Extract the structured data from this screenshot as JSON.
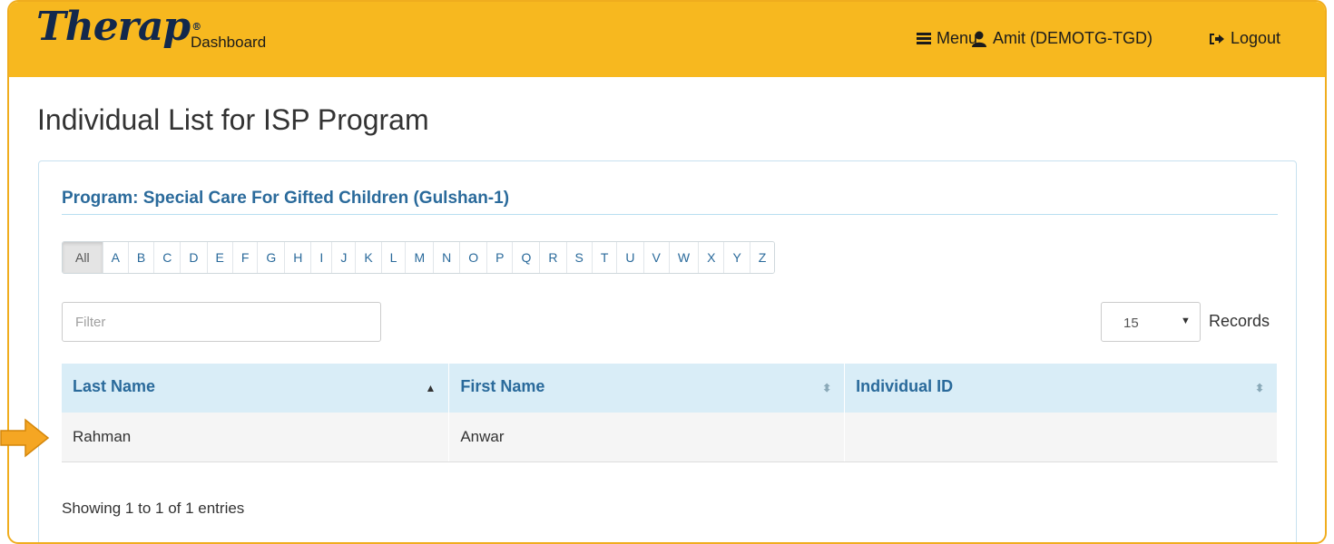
{
  "navbar": {
    "logo_text": "Therap",
    "logo_mark": "®",
    "dashboard_label": "Dashboard",
    "menu_label": "Menu",
    "user_label": "Amit (DEMOTG-TGD)",
    "logout_label": "Logout"
  },
  "page": {
    "title": "Individual List for ISP Program"
  },
  "panel": {
    "program_title": "Program: Special Care For Gifted Children (Gulshan-1)",
    "alphabet": [
      "All",
      "A",
      "B",
      "C",
      "D",
      "E",
      "F",
      "G",
      "H",
      "I",
      "J",
      "K",
      "L",
      "M",
      "N",
      "O",
      "P",
      "Q",
      "R",
      "S",
      "T",
      "U",
      "V",
      "W",
      "X",
      "Y",
      "Z"
    ],
    "active_letter": "All",
    "filter_placeholder": "Filter",
    "records_value": "15",
    "records_label": "Records",
    "columns": [
      "Last Name",
      "First Name",
      "Individual ID"
    ],
    "rows": [
      {
        "last_name": "Rahman",
        "first_name": "Anwar",
        "individual_id": ""
      }
    ],
    "entries_text": "Showing 1 to 1 of 1 entries"
  },
  "colors": {
    "navbar": "#f7b81f",
    "accent_blue": "#2a6a9b",
    "header_bg": "#d9edf7",
    "arrow": "#f5a623"
  }
}
